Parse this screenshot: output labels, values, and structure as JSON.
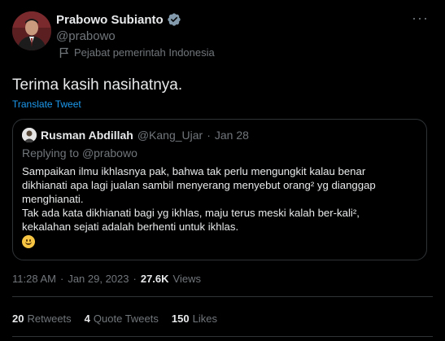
{
  "author": {
    "display_name": "Prabowo Subianto",
    "handle": "@prabowo",
    "label": "Pejabat pemerintah Indonesia",
    "more_icon": "more-icon"
  },
  "tweet": {
    "text": "Terima kasih nasihatnya.",
    "translate_label": "Translate Tweet"
  },
  "quote": {
    "name": "Rusman Abdillah",
    "handle": "@Kang_Ujar",
    "dot": "·",
    "date": "Jan 28",
    "reply_prefix": "Replying to ",
    "reply_handle": "@prabowo",
    "lines": [
      "Sampaikan ilmu ikhlasnya pak, bahwa tak perlu mengungkit kalau benar",
      "dikhianati apa lagi jualan sambil menyerang menyebut orang² yg dianggap",
      "menghianati.",
      "Tak ada kata dikhianati bagi yg ikhlas, maju terus meski kalah ber-kali²,",
      "kekalahan sejati adalah berhenti untuk ikhlas."
    ]
  },
  "meta": {
    "time": "11:28 AM",
    "dot1": "·",
    "date": "Jan 29, 2023",
    "dot2": "·",
    "views_count": "27.6K",
    "views_label": "Views"
  },
  "stats": {
    "retweets_count": "20",
    "retweets_label": "Retweets",
    "quotes_count": "4",
    "quotes_label": "Quote Tweets",
    "likes_count": "150",
    "likes_label": "Likes"
  },
  "colors": {
    "background": "#000000",
    "text": "#e7e9ea",
    "muted": "#71767b",
    "link": "#1d9bf0",
    "border": "#2f3336",
    "verified": "#829aab"
  }
}
